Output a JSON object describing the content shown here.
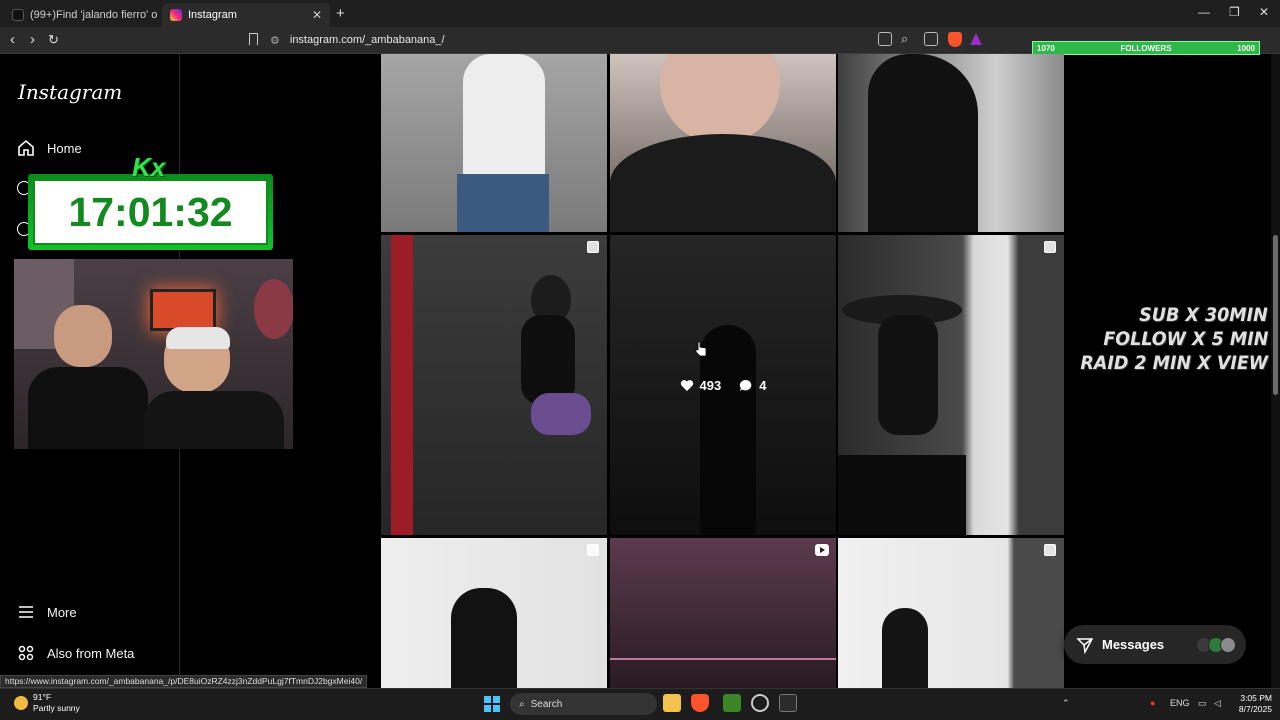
{
  "browser": {
    "tabs": [
      {
        "title": "(99+)Find 'jalando fierro' on TikTok |",
        "active": false,
        "favicon_color": "#111111"
      },
      {
        "title": "Instagram",
        "active": true,
        "favicon_color": "#e1306c"
      }
    ],
    "url": "instagram.com/_ambabanana_/",
    "status_url": "https://www.instagram.com/_ambabanana_/p/DE8uiOzRZ4zzj3nZddPuLgj7fTmnDJ2bgxMei40/"
  },
  "stream": {
    "followers": {
      "current": "1070",
      "label": "FOLLOWERS",
      "goal": "1000"
    },
    "timer": "17:01:32",
    "timer_logo": "Kx",
    "lines": [
      "SUB X 30MIN",
      "FOLLOW X 5 MIN",
      "RAID 2 MIN X VIEW"
    ]
  },
  "sidebar": {
    "logo": "Instagram",
    "items": [
      {
        "label": "Home",
        "icon": "home-icon"
      },
      {
        "label": "More",
        "icon": "menu-icon"
      },
      {
        "label": "Also from Meta",
        "icon": "meta-icon"
      }
    ]
  },
  "hover_post": {
    "likes": "493",
    "comments": "4"
  },
  "messages": {
    "label": "Messages"
  },
  "taskbar": {
    "weather_temp": "91°F",
    "weather_desc": "Partly sunny",
    "search_placeholder": "Search",
    "language": "ENG",
    "time": "3:05 PM",
    "date": "8/7/2025"
  },
  "colors": {
    "followers_bar": "#2fb84a",
    "timer_green": "#138a20",
    "ig_background": "#000000"
  }
}
